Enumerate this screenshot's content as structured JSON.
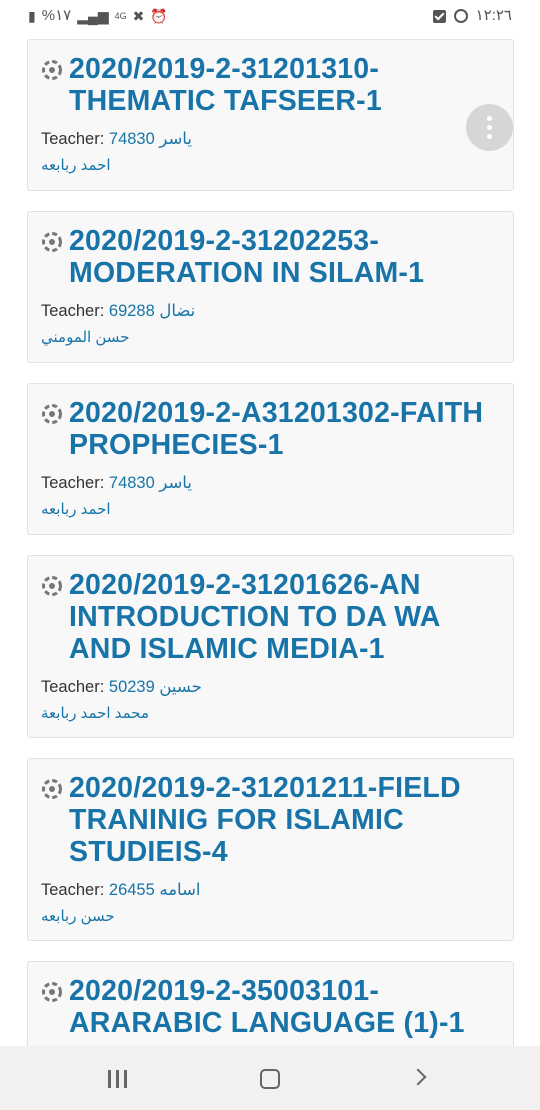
{
  "status_bar": {
    "battery_percent": "%١٧",
    "network": "4G",
    "time": "١٢:٢٦"
  },
  "courses": [
    {
      "title": "2020/2019-2-31201310-THEMATIC TAFSEER-1",
      "teacher_label": "Teacher:",
      "teacher_link": "74830 ياسر",
      "teacher_name": "احمد ربابعه"
    },
    {
      "title": "2020/2019-2-31202253-MODERATION IN SILAM-1",
      "teacher_label": "Teacher:",
      "teacher_link": "69288 نضال",
      "teacher_name": "حسن المومني"
    },
    {
      "title": "2020/2019-2-A31201302-FAITH PROPHECIES-1",
      "teacher_label": "Teacher:",
      "teacher_link": "74830 ياسر",
      "teacher_name": "احمد ربابعه"
    },
    {
      "title": "2020/2019-2-31201626-AN INTRODUCTION TO DA WA AND ISLAMIC MEDIA-1",
      "teacher_label": "Teacher:",
      "teacher_link": "50239 حسين",
      "teacher_name": "محمد احمد ربابعة"
    },
    {
      "title": "2020/2019-2-31201211-FIELD TRANINIG FOR ISLAMIC STUDIEIS-4",
      "teacher_label": "Teacher:",
      "teacher_link": "26455 اسامه",
      "teacher_name": "حسن ربابعه"
    },
    {
      "title": "2020/2019-2-35003101-ARARABIC LANGUAGE (1)-1"
    }
  ],
  "icons": {
    "course": "course-icon",
    "menu": "more-vert-icon",
    "nav_recents": "recents-icon",
    "nav_home": "home-icon",
    "nav_back": "back-icon"
  },
  "colors": {
    "link": "#1874a8",
    "card_bg": "#f8f8f8",
    "card_border": "#e2e2e2",
    "nav_bg": "#f1f1f1"
  }
}
